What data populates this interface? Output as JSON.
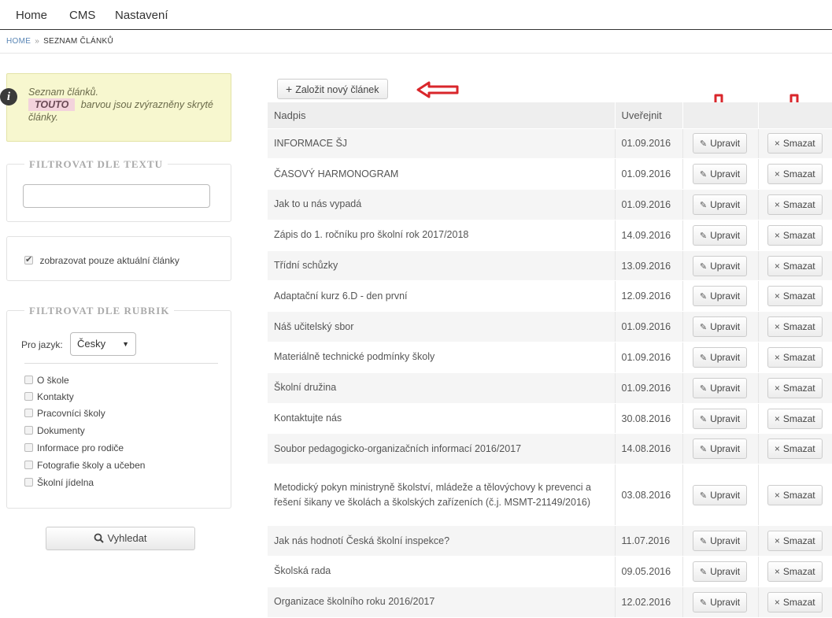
{
  "topnav": {
    "items": [
      "Home",
      "CMS",
      "Nastavení"
    ]
  },
  "breadcrumb": {
    "home": "HOME",
    "separator": "»",
    "current": "SEZNAM ČLÁNKŮ"
  },
  "info": {
    "line1": "Seznam článků.",
    "highlight": "TOUTO",
    "line2": "barvou jsou zvýrazněny skryté články."
  },
  "filter_text": {
    "legend": "FILTROVAT DLE TEXTU",
    "value": ""
  },
  "current_only": {
    "label": "zobrazovat pouze aktuální články",
    "checked": true
  },
  "filter_rubriky": {
    "legend": "FILTROVAT DLE RUBRIK",
    "lang_label": "Pro jazyk:",
    "lang_value": "Česky",
    "items": [
      "O škole",
      "Kontakty",
      "Pracovníci školy",
      "Dokumenty",
      "Informace pro rodiče",
      "Fotografie školy a učeben",
      "Školní jídelna"
    ]
  },
  "search_button": "Vyhledat",
  "add_button": "Založit nový článek",
  "table": {
    "headers": {
      "title": "Nadpis",
      "date": "Uveřejnit"
    },
    "edit_label": "Upravit",
    "delete_label": "Smazat",
    "rows": [
      {
        "title": "INFORMACE ŠJ",
        "date": "01.09.2016"
      },
      {
        "title": "ČASOVÝ HARMONOGRAM",
        "date": "01.09.2016"
      },
      {
        "title": "Jak to u nás vypadá",
        "date": "01.09.2016"
      },
      {
        "title": "Zápis do 1. ročníku pro školní rok 2017/2018",
        "date": "14.09.2016"
      },
      {
        "title": "Třídní schůzky",
        "date": "13.09.2016"
      },
      {
        "title": "Adaptační kurz 6.D - den první",
        "date": "12.09.2016"
      },
      {
        "title": "Náš učitelský sbor",
        "date": "01.09.2016"
      },
      {
        "title": "Materiálně technické podmínky školy",
        "date": "01.09.2016"
      },
      {
        "title": "Školní družina",
        "date": "01.09.2016"
      },
      {
        "title": "Kontaktujte nás",
        "date": "30.08.2016"
      },
      {
        "title": "Soubor pedagogicko-organizačních informací 2016/2017",
        "date": "14.08.2016"
      },
      {
        "title": "Metodický pokyn ministryně školství, mládeže a tělovýchovy k prevenci a řešení šikany ve školách a školských zařízeních (č.j. MSMT-21149/2016)",
        "date": "03.08.2016"
      },
      {
        "title": "Jak nás hodnotí Česká školní inspekce?",
        "date": "11.07.2016"
      },
      {
        "title": "Školská rada",
        "date": "09.05.2016"
      },
      {
        "title": "Organizace školního roku 2016/2017",
        "date": "12.02.2016"
      }
    ]
  },
  "colors": {
    "annotation_arrow": "#d9262b",
    "highlight": "#f3d3dc",
    "info_bg": "#f7f7cf"
  }
}
